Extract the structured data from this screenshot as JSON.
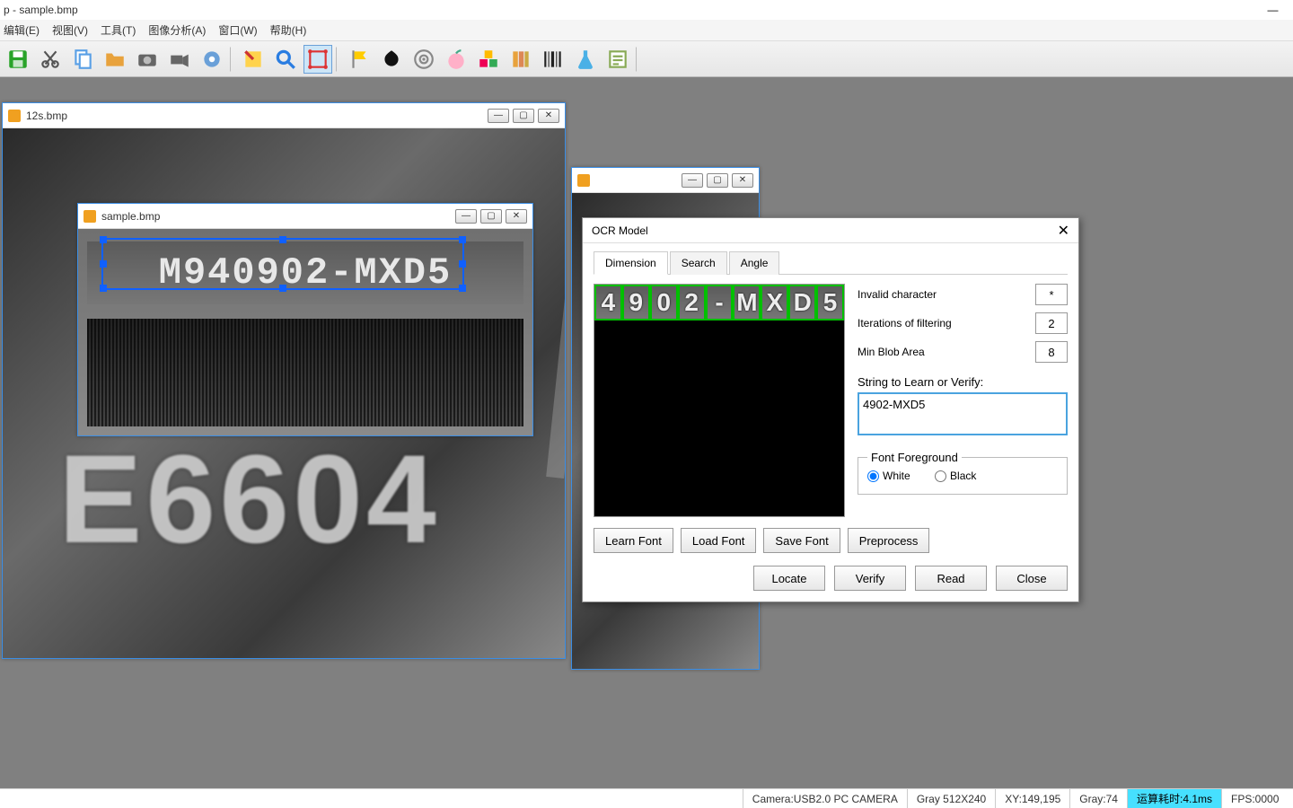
{
  "app": {
    "title_fragment": "p - sample.bmp"
  },
  "menu": {
    "edit": "编辑(E)",
    "view": "视图(V)",
    "tools": "工具(T)",
    "image_analysis": "图像分析(A)",
    "window": "窗口(W)",
    "help": "帮助(H)"
  },
  "toolbar_icons": [
    "save",
    "cut",
    "copy",
    "open",
    "camera",
    "camcorder",
    "gear",
    "note",
    "search",
    "select-rect",
    "flag",
    "inkblot",
    "target",
    "peach",
    "cubes",
    "books",
    "barcode",
    "flask",
    "notes"
  ],
  "child_windows": {
    "win1": {
      "title": "12s.bmp",
      "big_text": "E6604"
    },
    "win2": {
      "title": "sample.bmp",
      "ocr_text": "M940902-MXD5"
    },
    "win3_partial": true
  },
  "dialog": {
    "title": "OCR Model",
    "tabs": {
      "dimension": "Dimension",
      "search": "Search",
      "angle": "Angle",
      "active": "dimension"
    },
    "preview_chars": [
      "4",
      "9",
      "0",
      "2",
      "-",
      "M",
      "X",
      "D",
      "5"
    ],
    "fields": {
      "invalid_char_label": "Invalid character",
      "invalid_char_value": "*",
      "iter_label": "Iterations of filtering",
      "iter_value": "2",
      "min_blob_label": "Min Blob Area",
      "min_blob_value": "8",
      "verify_label": "String to Learn or Verify:",
      "verify_value": "4902-MXD5"
    },
    "font_group": {
      "legend": "Font Foreground",
      "white": "White",
      "black": "Black",
      "selected": "white"
    },
    "buttons": {
      "learn": "Learn Font",
      "load": "Load Font",
      "save": "Save Font",
      "preprocess": "Preprocess",
      "locate": "Locate",
      "verifybtn": "Verify",
      "read": "Read",
      "close": "Close"
    }
  },
  "status": {
    "camera": "Camera:USB2.0 PC CAMERA",
    "gray_res": "Gray 512X240",
    "xy": "XY:149,195",
    "gray_val": "Gray:74",
    "timing": "运算耗时:4.1ms",
    "fps": "FPS:0000"
  }
}
